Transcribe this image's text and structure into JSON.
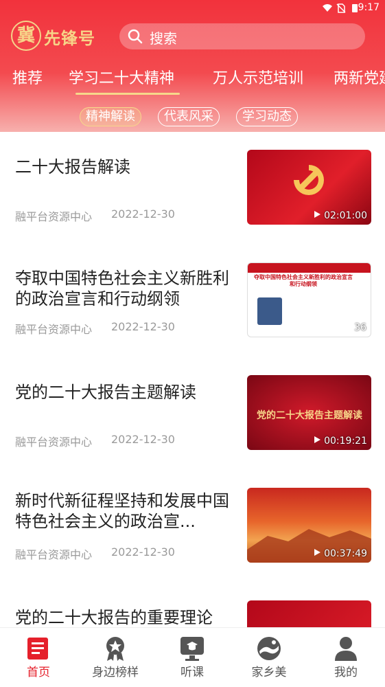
{
  "status": {
    "time": "9:17"
  },
  "logo": {
    "char": "冀",
    "text": "先锋号"
  },
  "search": {
    "placeholder": "搜索"
  },
  "tabs": [
    {
      "label": "推荐"
    },
    {
      "label": "学习二十大精神"
    },
    {
      "label": "万人示范培训"
    },
    {
      "label": "两新党建"
    }
  ],
  "subtabs": [
    {
      "label": "精神解读"
    },
    {
      "label": "代表风采"
    },
    {
      "label": "学习动态"
    }
  ],
  "items": [
    {
      "title": "二十大报告解读",
      "source": "融平台资源中心",
      "date": "2022-12-30",
      "duration": "02:01:00"
    },
    {
      "title": "夺取中国特色社会主义新胜利的政治宣言和行动纲领",
      "source": "融平台资源中心",
      "date": "2022-12-30",
      "duration": "36",
      "thumb_text": "夺取中国特色社会主义新胜利的政治宣言和行动纲领"
    },
    {
      "title": "党的二十大报告主题解读",
      "source": "融平台资源中心",
      "date": "2022-12-30",
      "duration": "00:19:21",
      "thumb_text": "党的二十大报告主题解读"
    },
    {
      "title": "新时代新征程坚持和发展中国特色社会主义的政治宣...",
      "source": "融平台资源中心",
      "date": "2022-12-30",
      "duration": "00:37:49"
    },
    {
      "title": "党的二十大报告的重要理论"
    }
  ],
  "nav": [
    {
      "label": "首页",
      "icon": "home-news-icon",
      "active": true
    },
    {
      "label": "身边榜样",
      "icon": "badge-star-icon"
    },
    {
      "label": "听课",
      "icon": "lecture-icon"
    },
    {
      "label": "家乡美",
      "icon": "landscape-icon"
    },
    {
      "label": "我的",
      "icon": "user-icon"
    }
  ],
  "colors": {
    "brand": "#f2323c",
    "accent": "#f6d88a"
  }
}
